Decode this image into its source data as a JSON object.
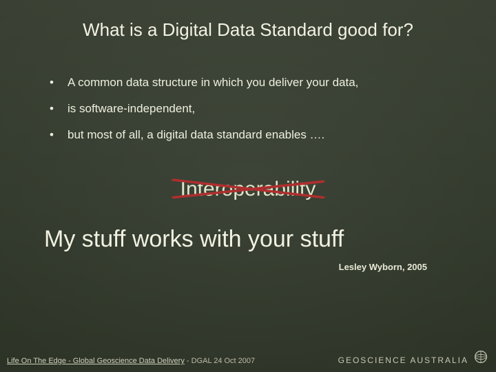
{
  "title": "What is a Digital Data Standard good for?",
  "bullets": {
    "items": [
      "A common data structure in which you deliver your data,",
      "is software-independent,",
      "but most of all, a digital data standard enables …."
    ]
  },
  "highlight": {
    "word": "Interoperability"
  },
  "statement": "My stuff works with your stuff",
  "attribution": "Lesley Wyborn, 2005",
  "footer": {
    "link_text": "Life On The Edge - Global Geoscience Data Delivery",
    "suffix": " - DGAL 24 Oct 2007",
    "brand": "GEOSCIENCE AUSTRALIA"
  },
  "colors": {
    "strike": "#b02e2e"
  }
}
